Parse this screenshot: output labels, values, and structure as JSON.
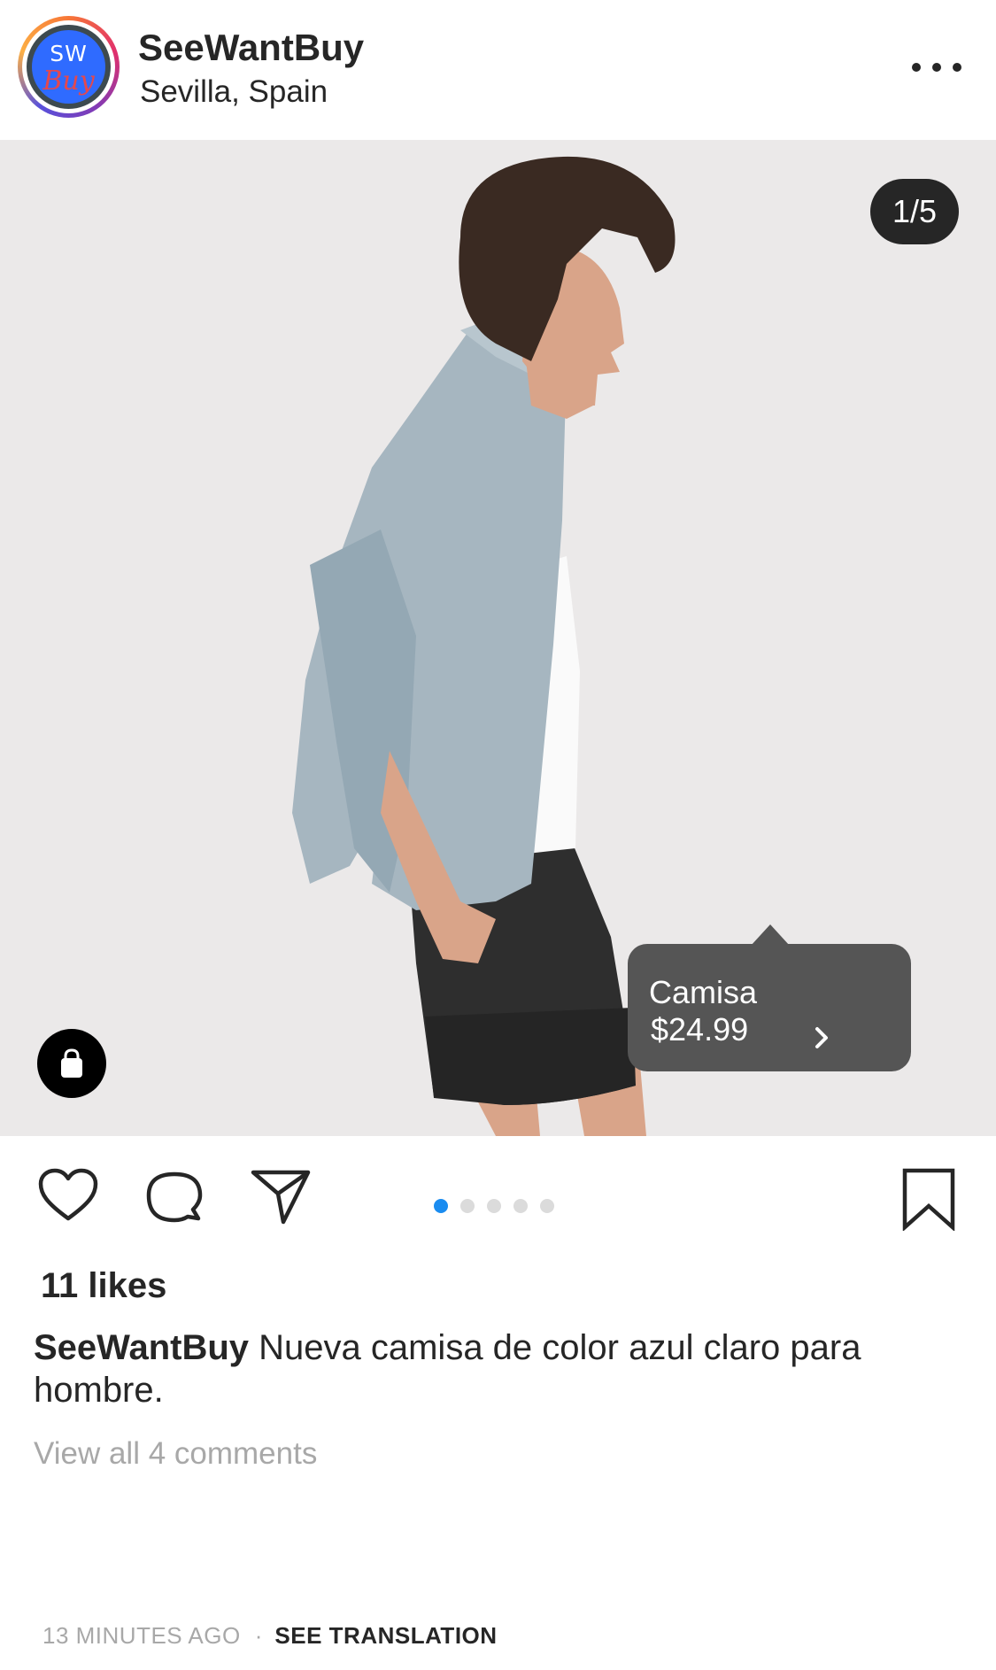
{
  "header": {
    "username": "SeeWantBuy",
    "location": "Sevilla, Spain",
    "avatar_text_top": "SW",
    "avatar_text_bottom": "Buy"
  },
  "photo": {
    "counter": "1/5",
    "product_tag": {
      "name": "Camisa",
      "price": "$24.99"
    }
  },
  "carousel": {
    "total": 5,
    "active": 1
  },
  "post": {
    "likes": "11 likes",
    "caption_user": "SeeWantBuy",
    "caption_text": " Nueva camisa de color azul claro para hombre.",
    "view_all_comments": "View all 4 comments",
    "timestamp": "13 MINUTES AGO",
    "separator": "·",
    "see_translation": "SEE TRANSLATION"
  },
  "icons": [
    "more-options-icon",
    "shopping-bag-icon",
    "heart-icon",
    "comment-icon",
    "share-icon",
    "bookmark-icon",
    "chevron-right-icon"
  ],
  "colors": {
    "accent": "#1a8cf0",
    "tag_bg": "#555555",
    "text": "#262626",
    "muted": "#a8a8a8"
  }
}
